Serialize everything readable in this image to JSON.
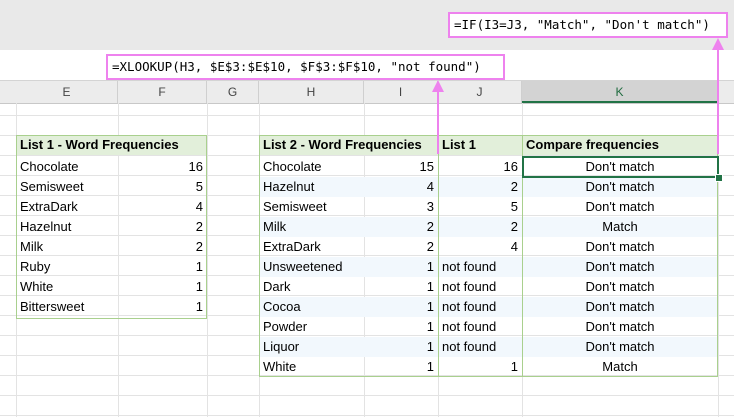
{
  "formulas": {
    "xlookup": "=XLOOKUP(H3, $E$3:$E$10, $F$3:$F$10, \"not found\")",
    "if": "=IF(I3=J3, \"Match\", \"Don't match\")"
  },
  "columns": [
    "E",
    "F",
    "G",
    "H",
    "I",
    "J",
    "K"
  ],
  "list1": {
    "header": "List 1 - Word Frequencies",
    "rows": [
      {
        "word": "Chocolate",
        "freq": "16"
      },
      {
        "word": "Semisweet",
        "freq": "5"
      },
      {
        "word": "ExtraDark",
        "freq": "4"
      },
      {
        "word": "Hazelnut",
        "freq": "2"
      },
      {
        "word": "Milk",
        "freq": "2"
      },
      {
        "word": "Ruby",
        "freq": "1"
      },
      {
        "word": "White",
        "freq": "1"
      },
      {
        "word": "Bittersweet",
        "freq": "1"
      }
    ]
  },
  "list2": {
    "header_h": "List 2 - Word Frequencies",
    "header_j": "List 1",
    "header_k": "Compare frequencies",
    "rows": [
      {
        "word": "Chocolate",
        "freq": "15",
        "list1": "16",
        "compare": "Don't match"
      },
      {
        "word": "Hazelnut",
        "freq": "4",
        "list1": "2",
        "compare": "Don't match"
      },
      {
        "word": "Semisweet",
        "freq": "3",
        "list1": "5",
        "compare": "Don't match"
      },
      {
        "word": "Milk",
        "freq": "2",
        "list1": "2",
        "compare": "Match"
      },
      {
        "word": "ExtraDark",
        "freq": "2",
        "list1": "4",
        "compare": "Don't match"
      },
      {
        "word": "Unsweetened",
        "freq": "1",
        "list1": "not found",
        "compare": "Don't match"
      },
      {
        "word": "Dark",
        "freq": "1",
        "list1": "not found",
        "compare": "Don't match"
      },
      {
        "word": "Cocoa",
        "freq": "1",
        "list1": "not found",
        "compare": "Don't match"
      },
      {
        "word": "Powder",
        "freq": "1",
        "list1": "not found",
        "compare": "Don't match"
      },
      {
        "word": "Liquor",
        "freq": "1",
        "list1": "not found",
        "compare": "Don't match"
      },
      {
        "word": "White",
        "freq": "1",
        "list1": "1",
        "compare": "Match"
      }
    ]
  },
  "colors": {
    "header_fill": "#e2efda",
    "table_border": "#a9d08e",
    "callout_magenta": "#ee82ee",
    "selection_green": "#217346",
    "banded_fill": "#f2f8fd"
  }
}
